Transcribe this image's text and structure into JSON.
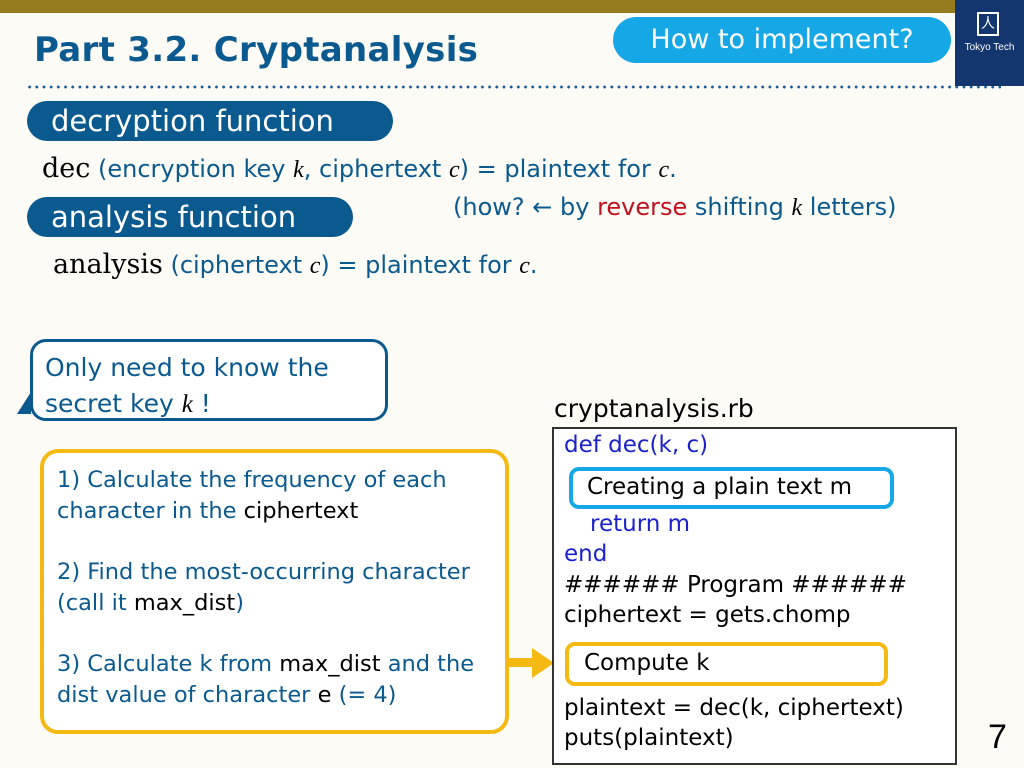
{
  "header": {
    "title": "Part 3.2.  Cryptanalysis",
    "how_button": "How to implement?",
    "logo_text": "Tokyo Tech",
    "logo_glyph": "⼈"
  },
  "colors": {
    "title_blue": "#0b5a8f",
    "top_bar": "#977c1f",
    "accent_cyan": "#16a8e6",
    "accent_yellow": "#f5b914",
    "logo_navy": "#14366e",
    "red": "#c0121e",
    "code_keyword": "#1a22c8"
  },
  "decryption": {
    "pill": "decryption function",
    "fn": "dec",
    "args_pre": " (encryption key ",
    "k": "k",
    "args_mid": ", ciphertext ",
    "c": "c",
    "args_post": ") = plaintext for ",
    "c2": "c",
    "end": ".",
    "how_pre": "(how? ← by ",
    "how_red": "reverse",
    "how_mid": " shifting ",
    "how_k": "k",
    "how_post": " letters)"
  },
  "analysis": {
    "pill": "analysis function",
    "fn": "analysis",
    "args_pre": " (ciphertext ",
    "c": "c",
    "args_post": ") = plaintext for ",
    "c2": "c",
    "end": "."
  },
  "callout": {
    "line1": "Only need to know the",
    "line2_pre": "secret key ",
    "k": "k",
    "line2_post": " !"
  },
  "steps": {
    "s1_pre": "1) Calculate the frequency of each character in the ",
    "s1_black": "ciphertext",
    "s2_pre": "2) Find the most-occurring character (call it ",
    "s2_black": "max_dist",
    "s2_post": ")",
    "s3_pre": "3) Calculate k from ",
    "s3_black1": "max_dist",
    "s3_mid": " and the dist value of character ",
    "s3_black2": "e",
    "s3_post": " (= 4)"
  },
  "code": {
    "filename": "cryptanalysis.rb",
    "lines": [
      "def dec(k, c)",
      "Creating a plain text m",
      "return m",
      "end",
      "###### Program ######",
      "ciphertext = gets.chomp",
      "Compute k",
      "plaintext = dec(k, ciphertext)",
      "puts(plaintext)"
    ]
  },
  "page_number": "7"
}
